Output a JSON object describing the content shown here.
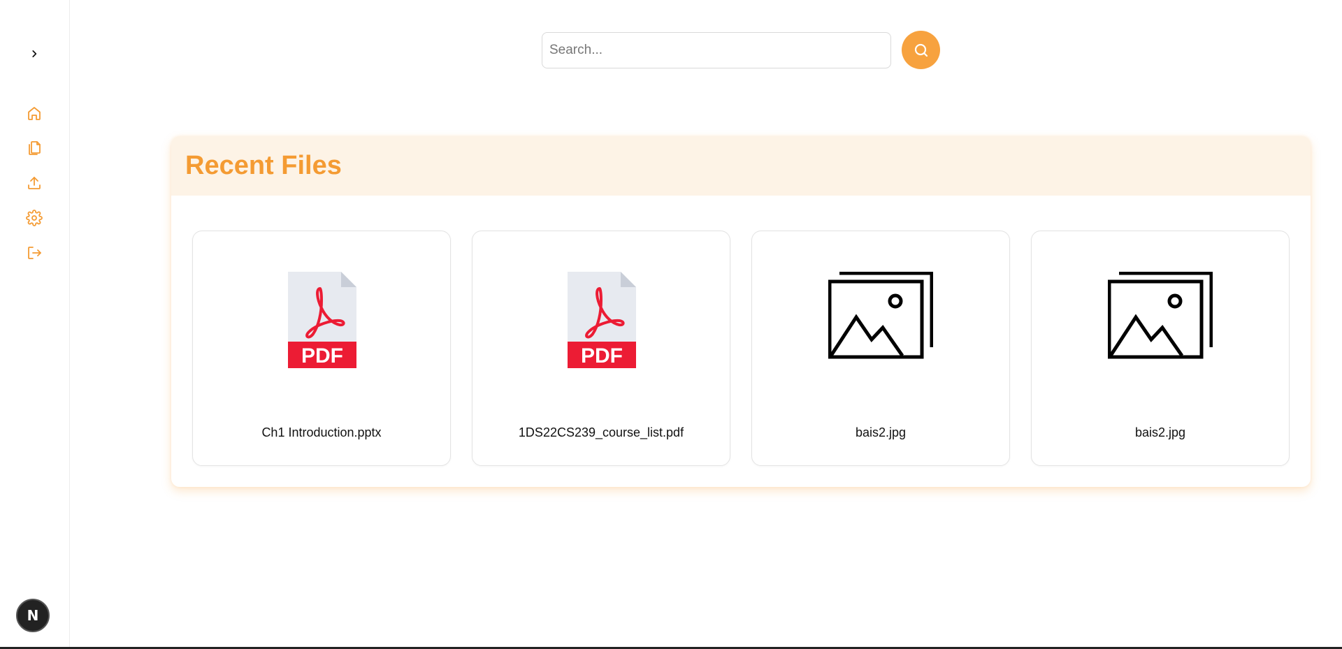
{
  "sidebar": {
    "toggle_icon": "chevron-right-icon",
    "items": [
      {
        "name": "home",
        "icon": "home-icon"
      },
      {
        "name": "files",
        "icon": "files-icon"
      },
      {
        "name": "upload",
        "icon": "upload-icon"
      },
      {
        "name": "settings",
        "icon": "gear-icon"
      },
      {
        "name": "logout",
        "icon": "logout-icon"
      }
    ],
    "badge_letter": "N"
  },
  "search": {
    "placeholder": "Search...",
    "value": ""
  },
  "recent_files": {
    "title": "Recent Files",
    "files": [
      {
        "name": "Ch1 Introduction.pptx",
        "icon": "pdf-icon"
      },
      {
        "name": "1DS22CS239_course_list.pdf",
        "icon": "pdf-icon"
      },
      {
        "name": "bais2.jpg",
        "icon": "image-icon"
      },
      {
        "name": "bais2.jpg",
        "icon": "image-icon"
      }
    ]
  },
  "colors": {
    "accent": "#f49b33",
    "search_button": "#f7a23f",
    "header_bg": "#fdf3e6",
    "pdf_red": "#ec1c34"
  }
}
